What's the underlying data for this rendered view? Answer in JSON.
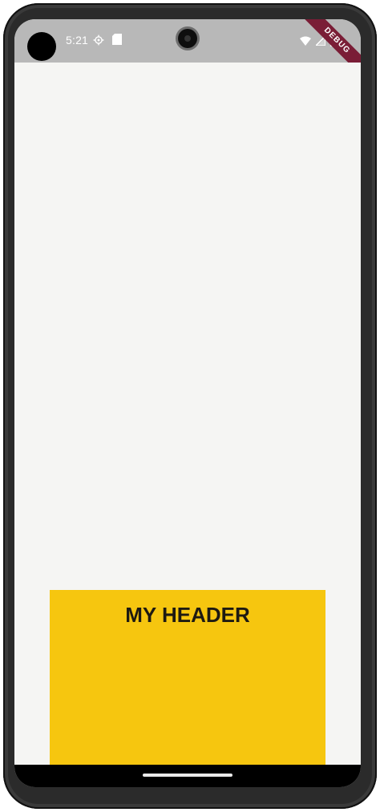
{
  "status_bar": {
    "time": "5:21",
    "debug_label": "DEBUG"
  },
  "header": {
    "title": "MY HEADER"
  },
  "colors": {
    "header_background": "#f6c60f",
    "screen_background": "#f5f5f3",
    "status_bar_background": "#b8b8b8",
    "debug_ribbon": "#7a1d36"
  },
  "icons": [
    "settings-icon",
    "sd-card-icon",
    "wifi-icon",
    "signal-icon",
    "battery-icon"
  ]
}
